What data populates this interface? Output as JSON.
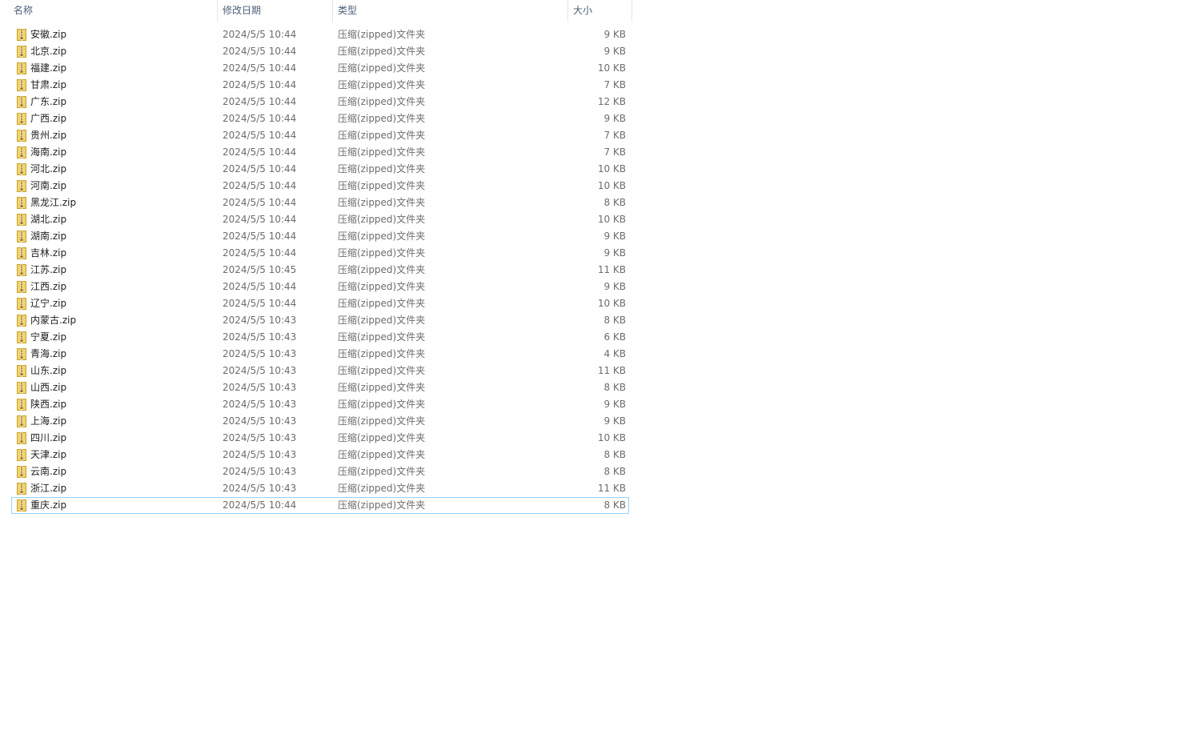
{
  "columns": {
    "name": "名称",
    "date": "修改日期",
    "type": "类型",
    "size": "大小"
  },
  "sort": {
    "column": "name",
    "direction": "ascending"
  },
  "colors": {
    "header_text": "#4c607a",
    "selection_border": "#99d1ff",
    "zip_icon_fill": "#f3d26b"
  },
  "files": [
    {
      "name": "安徽.zip",
      "date": "2024/5/5 10:44",
      "type": "压缩(zipped)文件夹",
      "size": "9 KB",
      "icon": "zip-folder-icon"
    },
    {
      "name": "北京.zip",
      "date": "2024/5/5 10:44",
      "type": "压缩(zipped)文件夹",
      "size": "9 KB",
      "icon": "zip-folder-icon"
    },
    {
      "name": "福建.zip",
      "date": "2024/5/5 10:44",
      "type": "压缩(zipped)文件夹",
      "size": "10 KB",
      "icon": "zip-folder-icon"
    },
    {
      "name": "甘肃.zip",
      "date": "2024/5/5 10:44",
      "type": "压缩(zipped)文件夹",
      "size": "7 KB",
      "icon": "zip-folder-icon"
    },
    {
      "name": "广东.zip",
      "date": "2024/5/5 10:44",
      "type": "压缩(zipped)文件夹",
      "size": "12 KB",
      "icon": "zip-folder-icon"
    },
    {
      "name": "广西.zip",
      "date": "2024/5/5 10:44",
      "type": "压缩(zipped)文件夹",
      "size": "9 KB",
      "icon": "zip-folder-icon"
    },
    {
      "name": "贵州.zip",
      "date": "2024/5/5 10:44",
      "type": "压缩(zipped)文件夹",
      "size": "7 KB",
      "icon": "zip-folder-icon"
    },
    {
      "name": "海南.zip",
      "date": "2024/5/5 10:44",
      "type": "压缩(zipped)文件夹",
      "size": "7 KB",
      "icon": "zip-folder-icon"
    },
    {
      "name": "河北.zip",
      "date": "2024/5/5 10:44",
      "type": "压缩(zipped)文件夹",
      "size": "10 KB",
      "icon": "zip-folder-icon"
    },
    {
      "name": "河南.zip",
      "date": "2024/5/5 10:44",
      "type": "压缩(zipped)文件夹",
      "size": "10 KB",
      "icon": "zip-folder-icon"
    },
    {
      "name": "黑龙江.zip",
      "date": "2024/5/5 10:44",
      "type": "压缩(zipped)文件夹",
      "size": "8 KB",
      "icon": "zip-folder-icon"
    },
    {
      "name": "湖北.zip",
      "date": "2024/5/5 10:44",
      "type": "压缩(zipped)文件夹",
      "size": "10 KB",
      "icon": "zip-folder-icon"
    },
    {
      "name": "湖南.zip",
      "date": "2024/5/5 10:44",
      "type": "压缩(zipped)文件夹",
      "size": "9 KB",
      "icon": "zip-folder-icon"
    },
    {
      "name": "吉林.zip",
      "date": "2024/5/5 10:44",
      "type": "压缩(zipped)文件夹",
      "size": "9 KB",
      "icon": "zip-folder-icon"
    },
    {
      "name": "江苏.zip",
      "date": "2024/5/5 10:45",
      "type": "压缩(zipped)文件夹",
      "size": "11 KB",
      "icon": "zip-folder-icon"
    },
    {
      "name": "江西.zip",
      "date": "2024/5/5 10:44",
      "type": "压缩(zipped)文件夹",
      "size": "9 KB",
      "icon": "zip-folder-icon"
    },
    {
      "name": "辽宁.zip",
      "date": "2024/5/5 10:44",
      "type": "压缩(zipped)文件夹",
      "size": "10 KB",
      "icon": "zip-folder-icon"
    },
    {
      "name": "内蒙古.zip",
      "date": "2024/5/5 10:43",
      "type": "压缩(zipped)文件夹",
      "size": "8 KB",
      "icon": "zip-folder-icon"
    },
    {
      "name": "宁夏.zip",
      "date": "2024/5/5 10:43",
      "type": "压缩(zipped)文件夹",
      "size": "6 KB",
      "icon": "zip-folder-icon"
    },
    {
      "name": "青海.zip",
      "date": "2024/5/5 10:43",
      "type": "压缩(zipped)文件夹",
      "size": "4 KB",
      "icon": "zip-folder-icon"
    },
    {
      "name": "山东.zip",
      "date": "2024/5/5 10:43",
      "type": "压缩(zipped)文件夹",
      "size": "11 KB",
      "icon": "zip-folder-icon"
    },
    {
      "name": "山西.zip",
      "date": "2024/5/5 10:43",
      "type": "压缩(zipped)文件夹",
      "size": "8 KB",
      "icon": "zip-folder-icon"
    },
    {
      "name": "陕西.zip",
      "date": "2024/5/5 10:43",
      "type": "压缩(zipped)文件夹",
      "size": "9 KB",
      "icon": "zip-folder-icon"
    },
    {
      "name": "上海.zip",
      "date": "2024/5/5 10:43",
      "type": "压缩(zipped)文件夹",
      "size": "9 KB",
      "icon": "zip-folder-icon"
    },
    {
      "name": "四川.zip",
      "date": "2024/5/5 10:43",
      "type": "压缩(zipped)文件夹",
      "size": "10 KB",
      "icon": "zip-folder-icon"
    },
    {
      "name": "天津.zip",
      "date": "2024/5/5 10:43",
      "type": "压缩(zipped)文件夹",
      "size": "8 KB",
      "icon": "zip-folder-icon"
    },
    {
      "name": "云南.zip",
      "date": "2024/5/5 10:43",
      "type": "压缩(zipped)文件夹",
      "size": "8 KB",
      "icon": "zip-folder-icon"
    },
    {
      "name": "浙江.zip",
      "date": "2024/5/5 10:43",
      "type": "压缩(zipped)文件夹",
      "size": "11 KB",
      "icon": "zip-folder-icon"
    },
    {
      "name": "重庆.zip",
      "date": "2024/5/5 10:44",
      "type": "压缩(zipped)文件夹",
      "size": "8 KB",
      "icon": "zip-folder-icon",
      "selected": true
    }
  ]
}
